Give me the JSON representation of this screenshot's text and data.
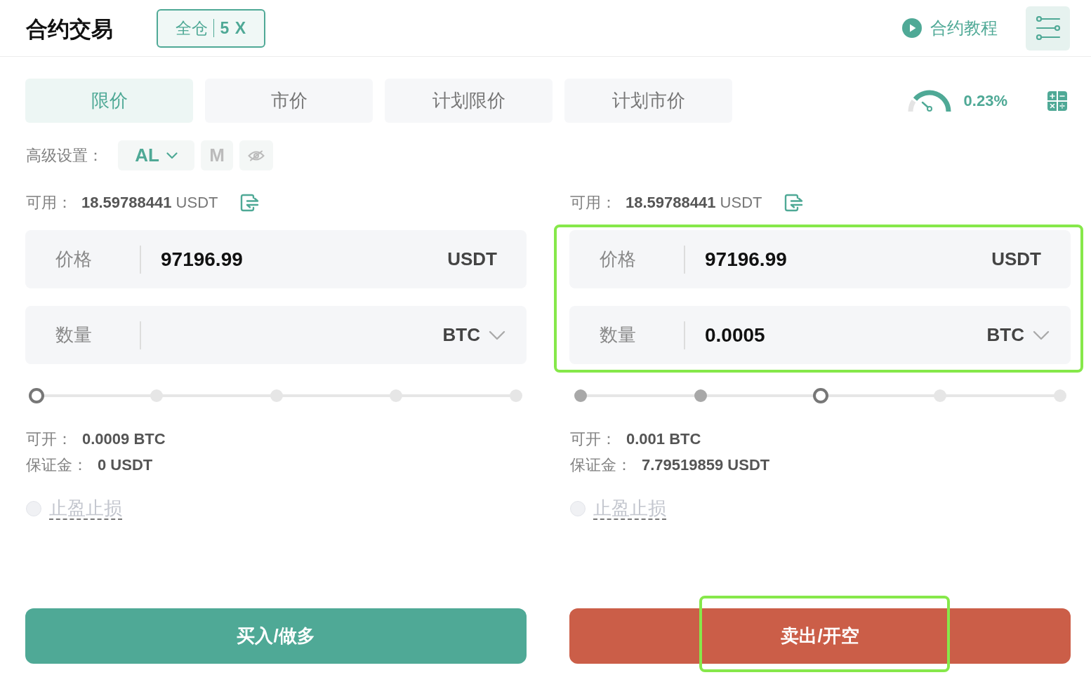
{
  "header": {
    "title": "合约交易",
    "margin_mode": {
      "mode": "全仓",
      "leverage": "5 X"
    },
    "tutorial_link": "合约教程"
  },
  "order_types": [
    {
      "label": "限价",
      "selected": true
    },
    {
      "label": "市价",
      "selected": false
    },
    {
      "label": "计划限价",
      "selected": false
    },
    {
      "label": "计划市价",
      "selected": false
    }
  ],
  "fee_gauge": {
    "reading": "0.23%"
  },
  "advanced_settings": {
    "label": "高级设置：",
    "options": [
      {
        "kind": "dropdown",
        "label": "AL",
        "on": true
      },
      {
        "kind": "text",
        "label": "M",
        "on": false
      },
      {
        "kind": "icon",
        "on": false
      }
    ]
  },
  "panels": [
    {
      "available": {
        "label": "可用：",
        "amount": "18.59788441",
        "unit": "USDT"
      },
      "fields_highlighted": false,
      "fields": [
        {
          "kind": "text",
          "label": "价格",
          "value": "97196.99",
          "unit": "USDT"
        },
        {
          "kind": "dropdown",
          "label": "数量",
          "unit": "BTC"
        }
      ],
      "slider": {
        "level": 0
      },
      "info": [
        {
          "label": "可开：",
          "value": "0.0009 BTC"
        },
        {
          "label": "保证金：",
          "value": "0 USDT"
        }
      ],
      "tp_sl": {
        "label": "止盈止损",
        "checked": false
      },
      "submit": {
        "kind": "buy",
        "label": "买入/做多",
        "highlighted": false
      }
    },
    {
      "available": {
        "label": "可用：",
        "amount": "18.59788441",
        "unit": "USDT"
      },
      "fields_highlighted": true,
      "fields": [
        {
          "kind": "text",
          "label": "价格",
          "value": "97196.99",
          "unit": "USDT"
        },
        {
          "kind": "dropdown",
          "label": "数量",
          "value": "0.0005",
          "unit": "BTC"
        }
      ],
      "slider": {
        "level": 0.5
      },
      "info": [
        {
          "label": "可开：",
          "value": "0.001 BTC"
        },
        {
          "label": "保证金：",
          "value": "7.79519859 USDT"
        }
      ],
      "tp_sl": {
        "label": "止盈止损",
        "checked": false
      },
      "submit": {
        "kind": "sell",
        "label": "卖出/开空",
        "highlighted": true
      }
    }
  ]
}
